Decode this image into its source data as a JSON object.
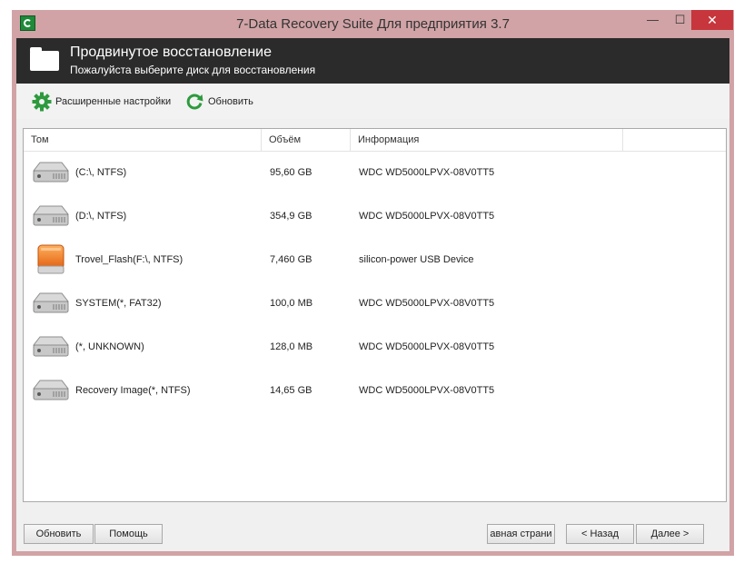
{
  "window": {
    "title": "7-Data Recovery Suite Для предприятия 3.7",
    "controls": {
      "minimize": "—",
      "maximize": "☐",
      "close": "✕"
    }
  },
  "header": {
    "title": "Продвинутое восстановление",
    "subtitle": "Пожалуйста выберите диск для восстановления"
  },
  "toolbar": {
    "advanced_settings": "Расширенные настройки",
    "refresh": "Обновить"
  },
  "table": {
    "columns": [
      "Том",
      "Объём",
      "Информация"
    ],
    "rows": [
      {
        "name": "(C:\\, NTFS)",
        "size": "95,60 GB",
        "info": "WDC WD5000LPVX-08V0TT5",
        "icon": "hard-drive-icon"
      },
      {
        "name": "(D:\\, NTFS)",
        "size": "354,9 GB",
        "info": "WDC WD5000LPVX-08V0TT5",
        "icon": "hard-drive-icon"
      },
      {
        "name": "Trovel_Flash(F:\\, NTFS)",
        "size": "7,460 GB",
        "info": "silicon-power USB Device",
        "icon": "usb-drive-icon"
      },
      {
        "name": "SYSTEM(*, FAT32)",
        "size": "100,0 MB",
        "info": "WDC WD5000LPVX-08V0TT5",
        "icon": "hard-drive-icon"
      },
      {
        "name": "(*, UNKNOWN)",
        "size": "128,0 MB",
        "info": "WDC WD5000LPVX-08V0TT5",
        "icon": "hard-drive-icon"
      },
      {
        "name": "Recovery Image(*, NTFS)",
        "size": "14,65 GB",
        "info": "WDC WD5000LPVX-08V0TT5",
        "icon": "hard-drive-icon"
      }
    ]
  },
  "footer": {
    "refresh": "Обновить",
    "help": "Помощь",
    "main_page": "авная страни",
    "back": "< Назад",
    "next": "Далее >"
  },
  "colors": {
    "window_frame": "#d1a3a6",
    "header_band": "#2b2b2b",
    "close_button": "#c7363c",
    "accent_green": "#2e9a3e",
    "usb_orange": "#f07a1e"
  }
}
